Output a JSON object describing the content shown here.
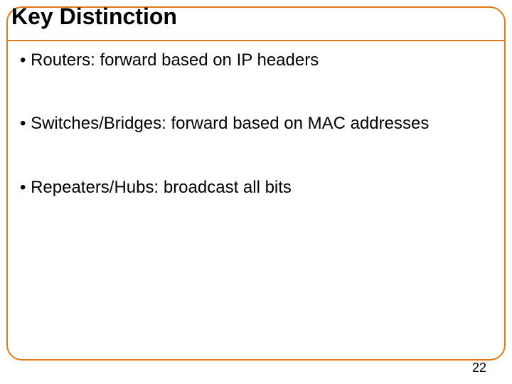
{
  "title": "Key Distinction",
  "bullets": [
    "Routers: forward based on IP headers",
    "Switches/Bridges: forward based on MAC addresses",
    "Repeaters/Hubs: broadcast all bits"
  ],
  "page_number": "22"
}
